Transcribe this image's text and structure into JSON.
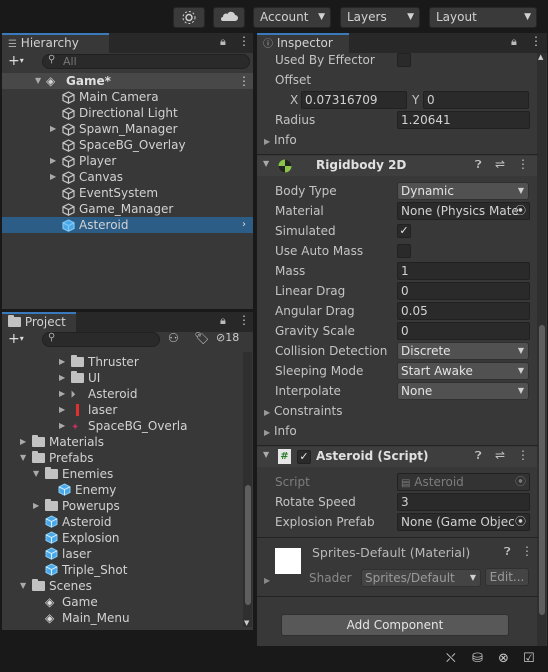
{
  "toolbar": {
    "account": "Account",
    "layers": "Layers",
    "layout": "Layout",
    "cloud_icon": "cloud-icon",
    "settings_icon": "gear-icon"
  },
  "hierarchy": {
    "tab": "Hierarchy",
    "search_placeholder": "All",
    "scene": "Game*",
    "items": [
      {
        "label": "Main Camera",
        "expandable": false
      },
      {
        "label": "Directional Light",
        "expandable": false
      },
      {
        "label": "Spawn_Manager",
        "expandable": true
      },
      {
        "label": "SpaceBG_Overlay",
        "expandable": false
      },
      {
        "label": "Player",
        "expandable": true
      },
      {
        "label": "Canvas",
        "expandable": true
      },
      {
        "label": "EventSystem",
        "expandable": false
      },
      {
        "label": "Game_Manager",
        "expandable": false
      },
      {
        "label": "Asteroid",
        "expandable": false,
        "selected": true
      }
    ]
  },
  "project": {
    "tab": "Project",
    "badge_count": "18",
    "items": [
      {
        "label": "Thruster",
        "kind": "folder",
        "depth": 3,
        "arrow": true
      },
      {
        "label": "UI",
        "kind": "folder",
        "depth": 3,
        "arrow": true
      },
      {
        "label": "Asteroid",
        "kind": "anim",
        "depth": 3,
        "arrow": true
      },
      {
        "label": "laser",
        "kind": "sprite",
        "depth": 3,
        "arrow": true
      },
      {
        "label": "SpaceBG_Overla",
        "kind": "sprite2",
        "depth": 3,
        "arrow": true
      },
      {
        "label": "Materials",
        "kind": "folder",
        "depth": 0,
        "arrow": true
      },
      {
        "label": "Prefabs",
        "kind": "folder",
        "depth": 0,
        "arrow": true,
        "open": true
      },
      {
        "label": "Enemies",
        "kind": "folder",
        "depth": 1,
        "arrow": true,
        "open": true
      },
      {
        "label": "Enemy",
        "kind": "cube",
        "depth": 2,
        "arrow": false
      },
      {
        "label": "Powerups",
        "kind": "folder",
        "depth": 1,
        "arrow": true
      },
      {
        "label": "Asteroid",
        "kind": "cube",
        "depth": 1,
        "arrow": false
      },
      {
        "label": "Explosion",
        "kind": "cube",
        "depth": 1,
        "arrow": false
      },
      {
        "label": "laser",
        "kind": "cube",
        "depth": 1,
        "arrow": false
      },
      {
        "label": "Triple_Shot",
        "kind": "cube",
        "depth": 1,
        "arrow": false
      },
      {
        "label": "Scenes",
        "kind": "folder",
        "depth": 0,
        "arrow": true,
        "open": true
      },
      {
        "label": "Game",
        "kind": "scene",
        "depth": 1,
        "arrow": false
      },
      {
        "label": "Main_Menu",
        "kind": "scene",
        "depth": 1,
        "arrow": false
      }
    ]
  },
  "inspector": {
    "tab": "Inspector",
    "collider": {
      "used_by_effector_label": "Used By Effector",
      "offset_label": "Offset",
      "offset_x_label": "X",
      "offset_x": "0.07316709",
      "offset_y_label": "Y",
      "offset_y": "0",
      "radius_label": "Radius",
      "radius": "1.20641",
      "info_label": "Info"
    },
    "rigidbody": {
      "title": "Rigidbody 2D",
      "body_type_label": "Body Type",
      "body_type": "Dynamic",
      "material_label": "Material",
      "material": "None (Physics Mate",
      "simulated_label": "Simulated",
      "auto_mass_label": "Use Auto Mass",
      "mass_label": "Mass",
      "mass": "1",
      "linear_drag_label": "Linear Drag",
      "linear_drag": "0",
      "angular_drag_label": "Angular Drag",
      "angular_drag": "0.05",
      "gravity_label": "Gravity Scale",
      "gravity": "0",
      "collision_label": "Collision Detection",
      "collision": "Discrete",
      "sleeping_label": "Sleeping Mode",
      "sleeping": "Start Awake",
      "interpolate_label": "Interpolate",
      "interpolate": "None",
      "constraints_label": "Constraints",
      "info_label": "Info"
    },
    "script": {
      "title": "Asteroid (Script)",
      "script_label": "Script",
      "script_value": "Asteroid",
      "rotate_label": "Rotate Speed",
      "rotate_value": "3",
      "explosion_label": "Explosion Prefab",
      "explosion_value": "None (Game Object)"
    },
    "material": {
      "title": "Sprites-Default (Material)",
      "shader_label": "Shader",
      "shader_value": "Sprites/Default",
      "edit_label": "Edit..."
    },
    "add_component": "Add Component"
  },
  "colors": {
    "selection": "#2c5d87",
    "accent": "#3a79bb",
    "panel": "#383838"
  }
}
